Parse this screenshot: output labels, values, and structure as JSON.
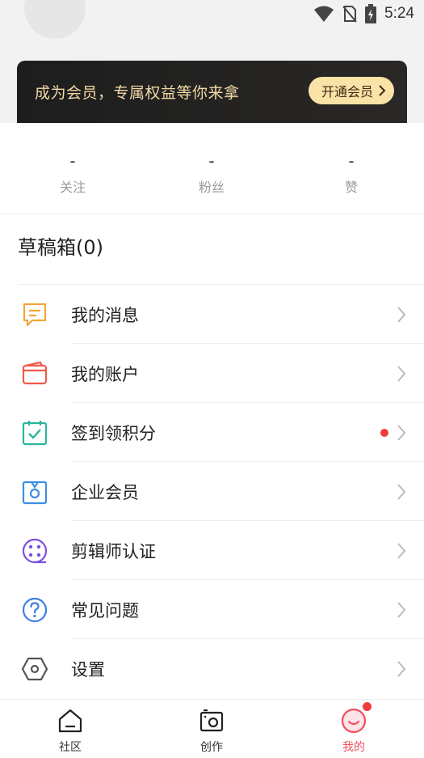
{
  "status_bar": {
    "time": "5:24",
    "icons": [
      "wifi-icon",
      "no-sim-icon",
      "battery-charging-icon"
    ]
  },
  "vip_banner": {
    "text": "成为会员，专属权益等你来拿",
    "button_label": "开通会员",
    "colors": {
      "bg": "#1d1d1d",
      "text": "#f3d9a6",
      "button": "#fbe2a6"
    }
  },
  "stats": [
    {
      "value": "-",
      "label": "关注"
    },
    {
      "value": "-",
      "label": "粉丝"
    },
    {
      "value": "-",
      "label": "赞"
    }
  ],
  "drafts": {
    "label": "草稿箱(0)"
  },
  "menu": [
    {
      "label": "我的消息",
      "icon": "message-icon",
      "color": "#f2a53a"
    },
    {
      "label": "我的账户",
      "icon": "wallet-icon",
      "color": "#ef5a4a"
    },
    {
      "label": "签到领积分",
      "icon": "calendar-check-icon",
      "color": "#2bb59a",
      "badge_dot": true
    },
    {
      "label": "企业会员",
      "icon": "enterprise-badge-icon",
      "color": "#3e8fe5"
    },
    {
      "label": "剪辑师认证",
      "icon": "film-reel-icon",
      "color": "#7b4fe0"
    },
    {
      "label": "常见问题",
      "icon": "question-icon",
      "color": "#3e7fe5"
    },
    {
      "label": "设置",
      "icon": "settings-hexagon-icon",
      "color": "#555555"
    }
  ],
  "nav": [
    {
      "label": "社区",
      "icon": "home-icon",
      "active": false
    },
    {
      "label": "创作",
      "icon": "camera-icon",
      "active": false
    },
    {
      "label": "我的",
      "icon": "smile-face-icon",
      "active": true
    }
  ],
  "accent_color": "#f04e5c"
}
